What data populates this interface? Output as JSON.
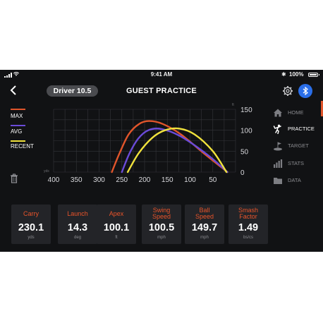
{
  "status_bar": {
    "time": "9:41 AM",
    "battery": "100%"
  },
  "header": {
    "club": "Driver 10.5",
    "title": "GUEST PRACTICE"
  },
  "legend": [
    {
      "label": "MAX",
      "color": "#e0552b"
    },
    {
      "label": "AVG",
      "color": "#6a4bd8"
    },
    {
      "label": "RECENT",
      "color": "#f0e23c"
    }
  ],
  "nav": [
    {
      "label": "HOME",
      "icon": "home-icon",
      "active": false
    },
    {
      "label": "PRACTICE",
      "icon": "golfer-icon",
      "active": true
    },
    {
      "label": "TARGET",
      "icon": "target-flag-icon",
      "active": false
    },
    {
      "label": "STATS",
      "icon": "stats-bars-icon",
      "active": false
    },
    {
      "label": "DATA",
      "icon": "folder-icon",
      "active": false
    }
  ],
  "chart_data": {
    "type": "line",
    "x_ticks": [
      400,
      350,
      300,
      250,
      200,
      150,
      100,
      50
    ],
    "x_unit": "yds",
    "y_ticks": [
      150,
      100,
      50,
      0
    ],
    "y_unit": "ft",
    "xlim": [
      0,
      400
    ],
    "ylim": [
      0,
      150
    ],
    "grid": true,
    "series": [
      {
        "name": "MAX",
        "color": "#e0552b",
        "points": [
          [
            272,
            0
          ],
          [
            255,
            45
          ],
          [
            235,
            90
          ],
          [
            212,
            115
          ],
          [
            190,
            122
          ],
          [
            160,
            115
          ],
          [
            120,
            90
          ],
          [
            70,
            45
          ],
          [
            18,
            0
          ]
        ]
      },
      {
        "name": "AVG",
        "color": "#6a4bd8",
        "points": [
          [
            250,
            0
          ],
          [
            233,
            45
          ],
          [
            214,
            80
          ],
          [
            192,
            100
          ],
          [
            163,
            103
          ],
          [
            120,
            85
          ],
          [
            60,
            40
          ],
          [
            18,
            0
          ]
        ]
      },
      {
        "name": "RECENT",
        "color": "#f0e23c",
        "points": [
          [
            237,
            0
          ],
          [
            213,
            45
          ],
          [
            183,
            82
          ],
          [
            155,
            100
          ],
          [
            124,
            104
          ],
          [
            90,
            90
          ],
          [
            50,
            50
          ],
          [
            20,
            0
          ]
        ]
      }
    ]
  },
  "metrics": [
    {
      "label": "Carry",
      "value": "230.1",
      "unit": "yds"
    },
    {
      "label": "Launch",
      "value": "14.3",
      "unit": "deg"
    },
    {
      "label": "Apex",
      "value": "100.1",
      "unit": "ft"
    },
    {
      "label": "Swing Speed",
      "value": "100.5",
      "unit": "mph"
    },
    {
      "label": "Ball Speed",
      "value": "149.7",
      "unit": "mph"
    },
    {
      "label": "Smash Factor",
      "value": "1.49",
      "unit": "bs/cs"
    }
  ]
}
